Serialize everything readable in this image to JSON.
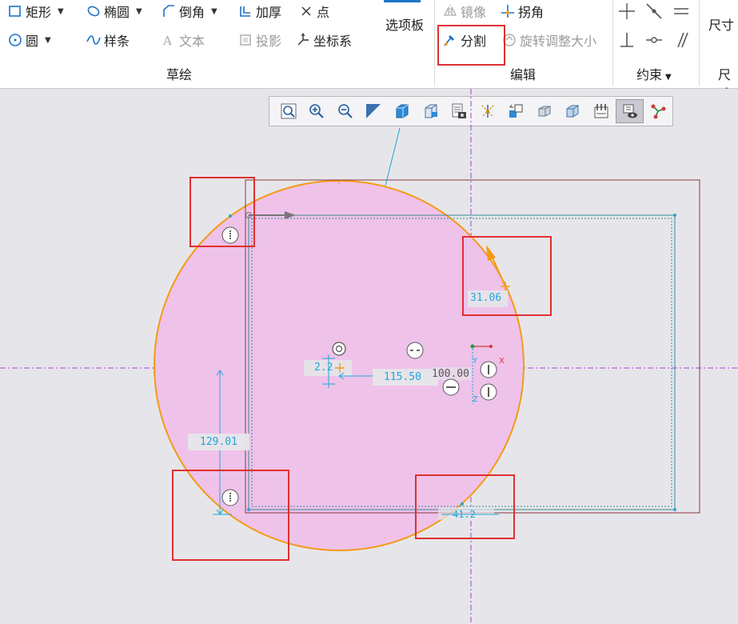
{
  "ribbon": {
    "sketch_group": {
      "label": "草绘",
      "rectangle": "矩形",
      "ellipse": "椭圆",
      "chamfer": "倒角",
      "thicken": "加厚",
      "point": "点",
      "circle": "圆",
      "spline": "样条",
      "text": "文本",
      "project": "投影",
      "coordinate_system": "坐标系",
      "palette": "选项板"
    },
    "edit_group": {
      "label": "编辑",
      "mirror": "镜像",
      "corner": "拐角",
      "divide": "分割",
      "rotate_resize": "旋转调整大小"
    },
    "constrain_group": {
      "label": "约束"
    },
    "dimension_group": {
      "label_top": "尺寸",
      "label_bottom": "尺寸"
    }
  },
  "view_toolbar": {
    "icons": [
      "zoom-fit-icon",
      "zoom-in-icon",
      "zoom-out-icon",
      "repaint-icon",
      "display-style-icon",
      "saved-orientations-icon",
      "view-manager-icon",
      "datum-display-icon",
      "annotation-display-icon",
      "spin-center-icon",
      "sketch-view-icon",
      "display-settings-icon",
      "sketcher-display-icon",
      "sketcher-constraints-icon"
    ],
    "active_icon": "sketcher-display-icon"
  },
  "sketch": {
    "dimensions": {
      "angle": "31.06",
      "radius_short": "2.2",
      "distance": "115.50",
      "height": "129.01",
      "bottom": "41.2"
    },
    "hidden_text": "100.00",
    "axis_labels": {
      "x": "X",
      "y": "Y",
      "z": "Z"
    }
  },
  "colors": {
    "circle_fill": "#efc2ea",
    "circle_stroke": "#f59a15",
    "rect_inner": "#3a8a94",
    "rect_outer": "#8b3540",
    "centerline": "#9e44d6",
    "dimension": "#1fa8d8",
    "highlight": "#e03030"
  }
}
